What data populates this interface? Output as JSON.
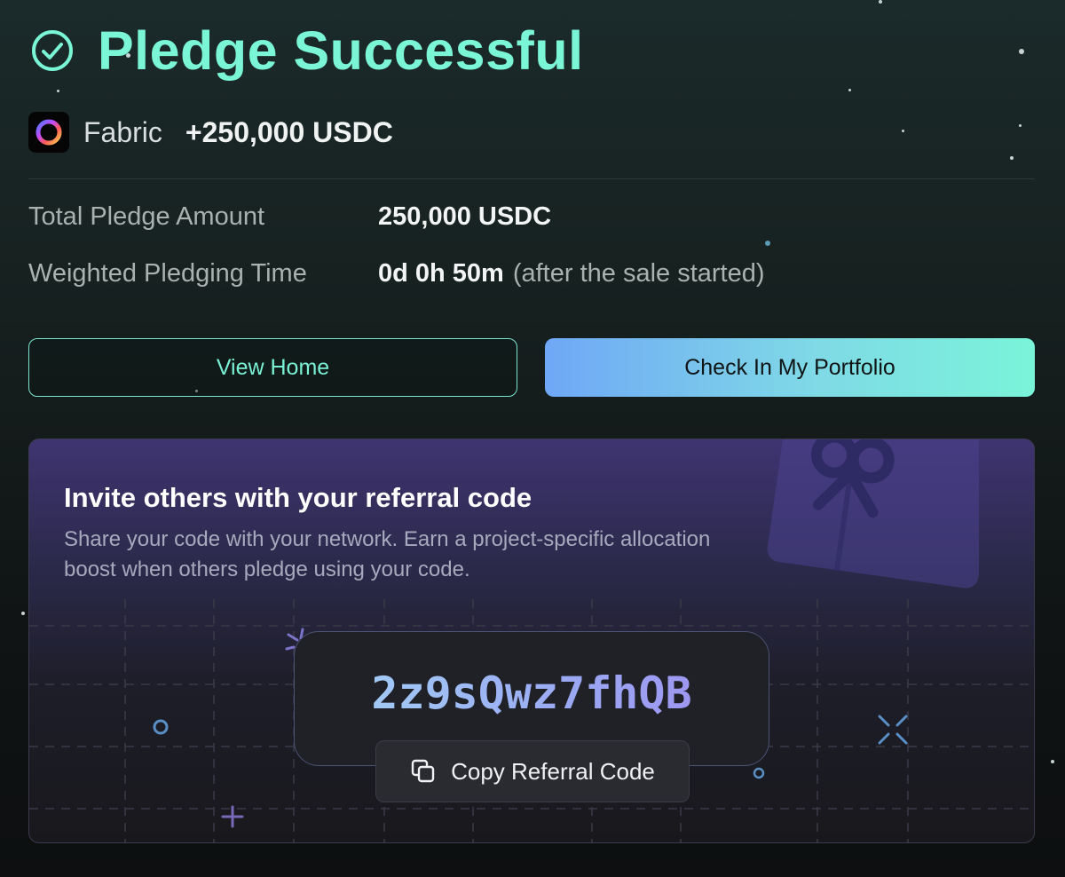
{
  "header": {
    "title": "Pledge Successful"
  },
  "token": {
    "name": "Fabric",
    "amount": "+250,000 USDC"
  },
  "details": {
    "total_label": "Total Pledge Amount",
    "total_value": "250,000 USDC",
    "time_label": "Weighted Pledging Time",
    "time_value": "0d 0h 50m",
    "time_note": "(after the sale started)"
  },
  "actions": {
    "view_home_label": "View Home",
    "portfolio_label": "Check In My Portfolio"
  },
  "referral": {
    "title": "Invite others with your referral code",
    "description": "Share your code with your network. Earn a project-specific allocation boost when others pledge using your code.",
    "code": "2z9sQwz7fhQB",
    "copy_label": "Copy Referral Code"
  },
  "colors": {
    "accent": "#7af5d6",
    "portfolio_gradient_start": "#6fa7f6",
    "portfolio_gradient_end": "#7af4d9",
    "referral_bg": "#3f3471"
  },
  "icons": [
    "check-circle-icon",
    "fabric-logo-icon",
    "gift-icon",
    "copy-icon"
  ]
}
